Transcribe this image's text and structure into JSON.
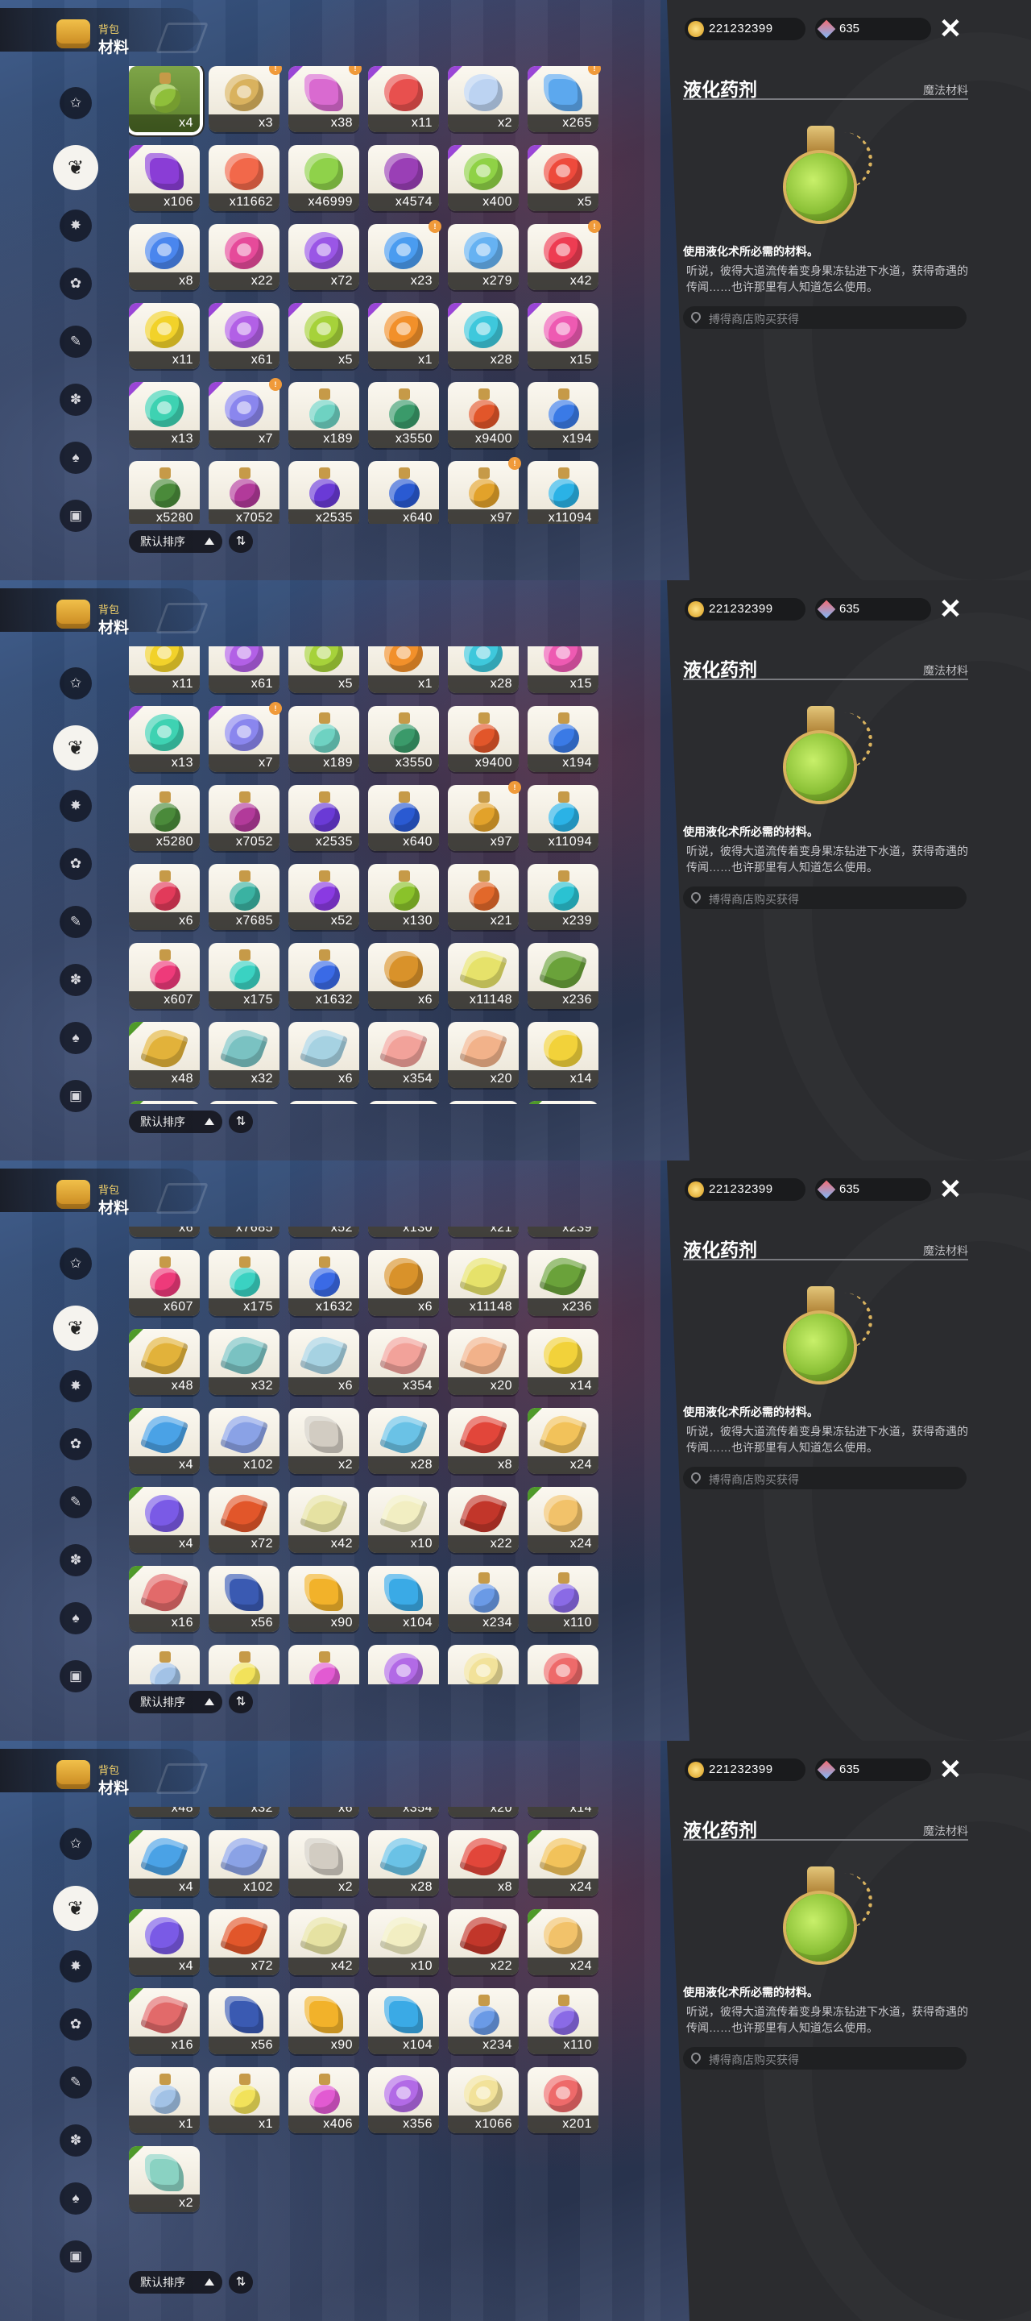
{
  "header": {
    "subtitle": "背包",
    "title": "材料"
  },
  "currency": {
    "coins": "221232399",
    "gems": "635"
  },
  "detail": {
    "name": "液化药剂",
    "category": "魔法材料",
    "usage": "使用液化术所必需的材料。",
    "lore": "听说，彼得大道流传着变身果冻钻进下水道，获得奇遇的传闻……也许那里有人知道怎么使用。",
    "source": "搏得商店购买获得"
  },
  "sort_label": "默认排序",
  "categories": [
    {
      "icon": "star-icon"
    },
    {
      "icon": "leaf-icon"
    },
    {
      "icon": "burst-icon"
    },
    {
      "icon": "sprout-icon"
    },
    {
      "icon": "scroll-icon"
    },
    {
      "icon": "paw-icon"
    },
    {
      "icon": "acorn-icon"
    },
    {
      "icon": "chest-icon"
    }
  ],
  "items": [
    {
      "count": "x4",
      "color": "#8fbf3a",
      "shape": "bottle",
      "badge": "selected"
    },
    {
      "count": "x3",
      "color": "#d9b25e",
      "shape": "ring",
      "new": true
    },
    {
      "count": "x38",
      "color": "#d96ad0",
      "shape": "crystal",
      "badge": "rare",
      "new": true
    },
    {
      "count": "x11",
      "color": "#e8504e",
      "shape": "gem",
      "badge": "rare"
    },
    {
      "count": "x2",
      "color": "#bcd3f2",
      "shape": "gem",
      "badge": "rare"
    },
    {
      "count": "x265",
      "color": "#5ca8ee",
      "shape": "crystal",
      "badge": "rare",
      "new": true
    },
    {
      "count": "x106",
      "color": "#8a3dd6",
      "shape": "crystal",
      "badge": "rare"
    },
    {
      "count": "x11662",
      "color": "#f2684a",
      "shape": "gem"
    },
    {
      "count": "x46999",
      "color": "#8fd24a",
      "shape": "gem"
    },
    {
      "count": "x4574",
      "color": "#9a3fb6",
      "shape": "gem"
    },
    {
      "count": "x400",
      "color": "#8fd246",
      "shape": "ring",
      "badge": "rare"
    },
    {
      "count": "x5",
      "color": "#ee4a3c",
      "shape": "ring",
      "badge": "rare"
    },
    {
      "count": "x8",
      "color": "#4a86ee",
      "shape": "ring"
    },
    {
      "count": "x22",
      "color": "#e64a9a",
      "shape": "ring"
    },
    {
      "count": "x72",
      "color": "#9a56e6",
      "shape": "ring"
    },
    {
      "count": "x23",
      "color": "#4a9cf0",
      "shape": "ring",
      "new": true
    },
    {
      "count": "x279",
      "color": "#66b2f2",
      "shape": "ring"
    },
    {
      "count": "x42",
      "color": "#ee3c52",
      "shape": "ring",
      "new": true
    },
    {
      "count": "x11",
      "color": "#f2d22a",
      "shape": "ring",
      "badge": "rare"
    },
    {
      "count": "x61",
      "color": "#b260e6",
      "shape": "ring",
      "badge": "rare"
    },
    {
      "count": "x5",
      "color": "#a6d23a",
      "shape": "ring",
      "badge": "rare"
    },
    {
      "count": "x1",
      "color": "#f2902a",
      "shape": "ring",
      "badge": "rare"
    },
    {
      "count": "x28",
      "color": "#3ec8dc",
      "shape": "ring",
      "badge": "rare"
    },
    {
      "count": "x15",
      "color": "#ee5ab2",
      "shape": "ring",
      "badge": "rare"
    },
    {
      "count": "x13",
      "color": "#3ed2b2",
      "shape": "ring",
      "badge": "rare"
    },
    {
      "count": "x7",
      "color": "#8a86ee",
      "shape": "ring",
      "badge": "rare",
      "new": true
    },
    {
      "count": "x189",
      "color": "#6ed2c2",
      "shape": "bottle"
    },
    {
      "count": "x3550",
      "color": "#3a9a6a",
      "shape": "bottle"
    },
    {
      "count": "x9400",
      "color": "#e2562a",
      "shape": "bottle"
    },
    {
      "count": "x194",
      "color": "#3a7ae6",
      "shape": "bottle"
    },
    {
      "count": "x5280",
      "color": "#4a8a3a",
      "shape": "bottle"
    },
    {
      "count": "x7052",
      "color": "#b23a9a",
      "shape": "bottle"
    },
    {
      "count": "x2535",
      "color": "#6a3ad6",
      "shape": "bottle"
    },
    {
      "count": "x640",
      "color": "#2a5ad2",
      "shape": "bottle"
    },
    {
      "count": "x97",
      "color": "#e2a22a",
      "shape": "bottle",
      "new": true
    },
    {
      "count": "x11094",
      "color": "#2ab2e6",
      "shape": "bottle"
    },
    {
      "count": "x6",
      "color": "#e23a5a",
      "shape": "bottle"
    },
    {
      "count": "x7685",
      "color": "#3ab2a2",
      "shape": "bottle"
    },
    {
      "count": "x52",
      "color": "#8a3ae2",
      "shape": "bottle"
    },
    {
      "count": "x130",
      "color": "#8ac22a",
      "shape": "bottle"
    },
    {
      "count": "x21",
      "color": "#e2682a",
      "shape": "bottle"
    },
    {
      "count": "x239",
      "color": "#2ac2d2",
      "shape": "bottle"
    },
    {
      "count": "x607",
      "color": "#ee3a7a",
      "shape": "bottle"
    },
    {
      "count": "x175",
      "color": "#3ad2c2",
      "shape": "bottle"
    },
    {
      "count": "x1632",
      "color": "#3a6ae6",
      "shape": "bottle"
    },
    {
      "count": "x6",
      "color": "#d9922a",
      "shape": "gem"
    },
    {
      "count": "x11148",
      "color": "#e6e26a",
      "shape": "flower"
    },
    {
      "count": "x236",
      "color": "#6aa23a",
      "shape": "flower"
    },
    {
      "count": "x48",
      "color": "#e2b23a",
      "shape": "flower",
      "badge": "epic"
    },
    {
      "count": "x32",
      "color": "#7ac2c2",
      "shape": "flower"
    },
    {
      "count": "x6",
      "color": "#a6d2e2",
      "shape": "flower"
    },
    {
      "count": "x354",
      "color": "#f2a29a",
      "shape": "flower"
    },
    {
      "count": "x20",
      "color": "#f2b28a",
      "shape": "flower"
    },
    {
      "count": "x14",
      "color": "#f2d23a",
      "shape": "gem"
    },
    {
      "count": "x4",
      "color": "#4aa2e6",
      "shape": "flower",
      "badge": "epic"
    },
    {
      "count": "x102",
      "color": "#8aa2e6",
      "shape": "flower"
    },
    {
      "count": "x2",
      "color": "#d2ccc2",
      "shape": "crystal"
    },
    {
      "count": "x28",
      "color": "#6ac2e6",
      "shape": "flower"
    },
    {
      "count": "x8",
      "color": "#e2463a",
      "shape": "flower"
    },
    {
      "count": "x24",
      "color": "#f2c25a",
      "shape": "flower",
      "badge": "epic"
    },
    {
      "count": "x4",
      "color": "#7a5ae6",
      "shape": "gem",
      "badge": "epic"
    },
    {
      "count": "x72",
      "color": "#e2562a",
      "shape": "flower"
    },
    {
      "count": "x42",
      "color": "#e6e2a2",
      "shape": "flower"
    },
    {
      "count": "x10",
      "color": "#f2eec2",
      "shape": "flower"
    },
    {
      "count": "x22",
      "color": "#c2362a",
      "shape": "flower"
    },
    {
      "count": "x24",
      "color": "#f2c26a",
      "shape": "gem",
      "badge": "epic"
    },
    {
      "count": "x16",
      "color": "#e26a6a",
      "shape": "flower",
      "badge": "epic"
    },
    {
      "count": "x56",
      "color": "#3a5ab2",
      "shape": "crystal"
    },
    {
      "count": "x90",
      "color": "#f2b22a",
      "shape": "crystal"
    },
    {
      "count": "x104",
      "color": "#3aaae6",
      "shape": "crystal"
    },
    {
      "count": "x234",
      "color": "#6a9ae6",
      "shape": "bottle"
    },
    {
      "count": "x110",
      "color": "#8a6ae6",
      "shape": "bottle"
    },
    {
      "count": "x1",
      "color": "#a2c2e6",
      "shape": "bottle"
    },
    {
      "count": "x1",
      "color": "#f2e25a",
      "shape": "bottle"
    },
    {
      "count": "x406",
      "color": "#e25ad2",
      "shape": "bottle"
    },
    {
      "count": "x356",
      "color": "#b26ae6",
      "shape": "ring"
    },
    {
      "count": "x1066",
      "color": "#f2e29a",
      "shape": "ring"
    },
    {
      "count": "x201",
      "color": "#ee6a6a",
      "shape": "ring"
    },
    {
      "count": "x2",
      "color": "#8ad2c2",
      "shape": "crystal",
      "badge": "epic"
    }
  ],
  "panels": [
    {
      "first_row": 0,
      "offset_rows": 0
    },
    {
      "first_row": 3,
      "offset_rows": 0.25
    },
    {
      "first_row": 6,
      "offset_rows": 0.7
    },
    {
      "first_row": 8,
      "offset_rows": 0.7
    }
  ]
}
